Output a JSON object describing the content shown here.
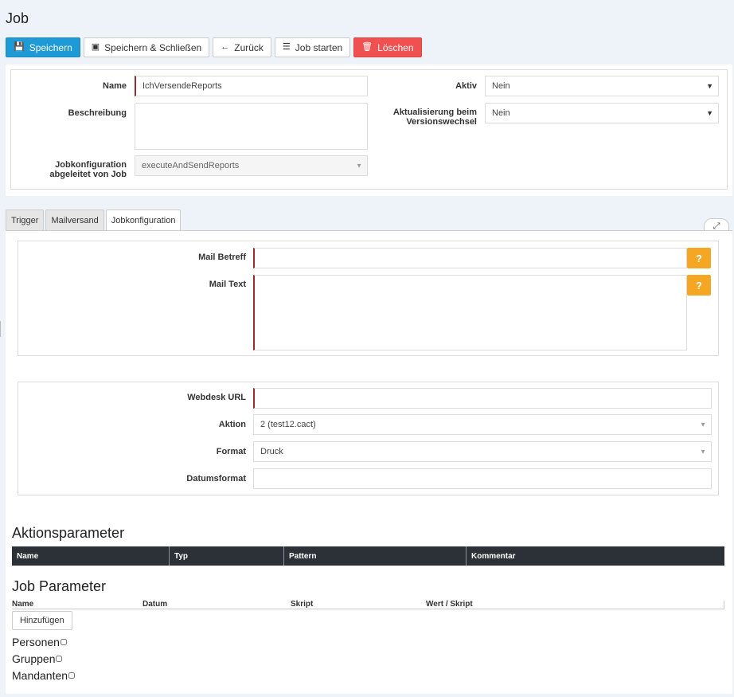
{
  "page": {
    "title": "Job"
  },
  "toolbar": {
    "save": "Speichern",
    "save_close": "Speichern & Schließen",
    "back": "Zurück",
    "start": "Job starten",
    "delete": "Löschen"
  },
  "form": {
    "name_label": "Name",
    "name_value": "IchVersendeReports",
    "desc_label": "Beschreibung",
    "desc_value": "",
    "jobconf_label_1": "Jobkonfiguration",
    "jobconf_label_2": "abgeleitet von Job",
    "jobconf_value": "executeAndSendReports",
    "aktiv_label": "Aktiv",
    "aktiv_value": "Nein",
    "update_label_1": "Aktualisierung beim",
    "update_label_2": "Versionswechsel",
    "update_value": "Nein"
  },
  "tabs": [
    "Trigger",
    "Mailversand",
    "Jobkonfiguration"
  ],
  "mail": {
    "subject_label": "Mail Betreff",
    "subject_value": "",
    "text_label": "Mail Text",
    "text_value": "",
    "help": "?"
  },
  "config": {
    "url_label": "Webdesk URL",
    "url_value": "",
    "action_label": "Aktion",
    "action_value": "2 (test12.cact)",
    "format_label": "Format",
    "format_value": "Druck",
    "date_label": "Datumsformat",
    "date_value": ""
  },
  "aktionsparameter": {
    "title": "Aktionsparameter",
    "columns": [
      "Name",
      "Typ",
      "Pattern",
      "Kommentar"
    ]
  },
  "jobparameter": {
    "title": "Job Parameter",
    "columns": [
      "Name",
      "Datum",
      "Skript",
      "Wert / Skript"
    ],
    "add": "Hinzufügen"
  },
  "checks": [
    "Personen",
    "Gruppen",
    "Mandanten"
  ]
}
